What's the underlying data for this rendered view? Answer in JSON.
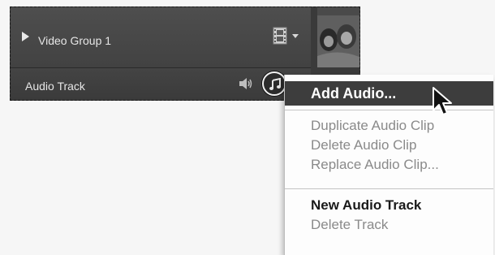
{
  "tracks": {
    "video_group": {
      "label": "Video Group 1",
      "disclosure_icon": "disclosure-triangle-right",
      "track_type_icon": "film-strip-icon"
    },
    "audio_track": {
      "label": "Audio Track",
      "volume_icon": "speaker-icon",
      "audio_menu_icon": "music-note-icon"
    }
  },
  "context_menu": {
    "items": [
      {
        "label": "Add Audio...",
        "state": "highlighted"
      },
      {
        "label": "Duplicate Audio Clip",
        "state": "disabled"
      },
      {
        "label": "Delete Audio Clip",
        "state": "disabled"
      },
      {
        "label": "Replace Audio Clip...",
        "state": "disabled"
      },
      {
        "label": "New Audio Track",
        "state": "enabled"
      },
      {
        "label": "Delete Track",
        "state": "disabled"
      }
    ]
  },
  "colors": {
    "panel_background": "#3a3a3a",
    "menu_highlight": "#3d3d3d",
    "menu_disabled_text": "#8a8a8a"
  }
}
